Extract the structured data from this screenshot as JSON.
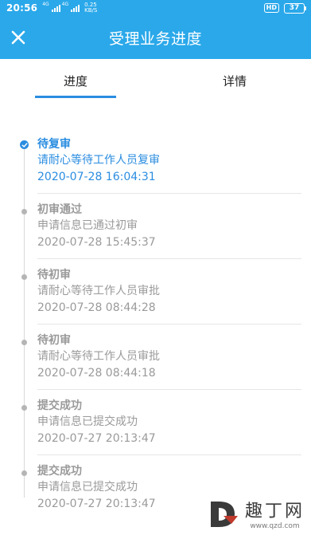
{
  "status_bar": {
    "time": "20:56",
    "net_label_1": "4G",
    "net_label_2": "4G",
    "speed_value": "0.25",
    "speed_unit": "KB/S",
    "hd_label": "HD",
    "battery_level": "37"
  },
  "header": {
    "title": "受理业务进度",
    "close_icon": "close-icon"
  },
  "tabs": [
    {
      "label": "进度",
      "selected": true
    },
    {
      "label": "详情",
      "selected": false
    }
  ],
  "timeline": [
    {
      "status": "待复审",
      "desc": "请耐心等待工作人员复审",
      "time": "2020-07-28 16:04:31",
      "active": true
    },
    {
      "status": "初审通过",
      "desc": "申请信息已通过初审",
      "time": "2020-07-28 15:45:37",
      "active": false
    },
    {
      "status": "待初审",
      "desc": "请耐心等待工作人员审批",
      "time": "2020-07-28 08:44:28",
      "active": false
    },
    {
      "status": "待初审",
      "desc": "请耐心等待工作人员审批",
      "time": "2020-07-28 08:44:18",
      "active": false
    },
    {
      "status": "提交成功",
      "desc": "申请信息已提交成功",
      "time": "2020-07-27 20:13:47",
      "active": false
    },
    {
      "status": "提交成功",
      "desc": "申请信息已提交成功",
      "time": "2020-07-27 20:13:47",
      "active": false
    }
  ],
  "watermark": {
    "brand": "趣丁网",
    "url": "www.qzd.com"
  },
  "colors": {
    "header_bg": "#2aa8ea",
    "accent": "#2a8de0",
    "muted_text": "#9a9a9a"
  }
}
